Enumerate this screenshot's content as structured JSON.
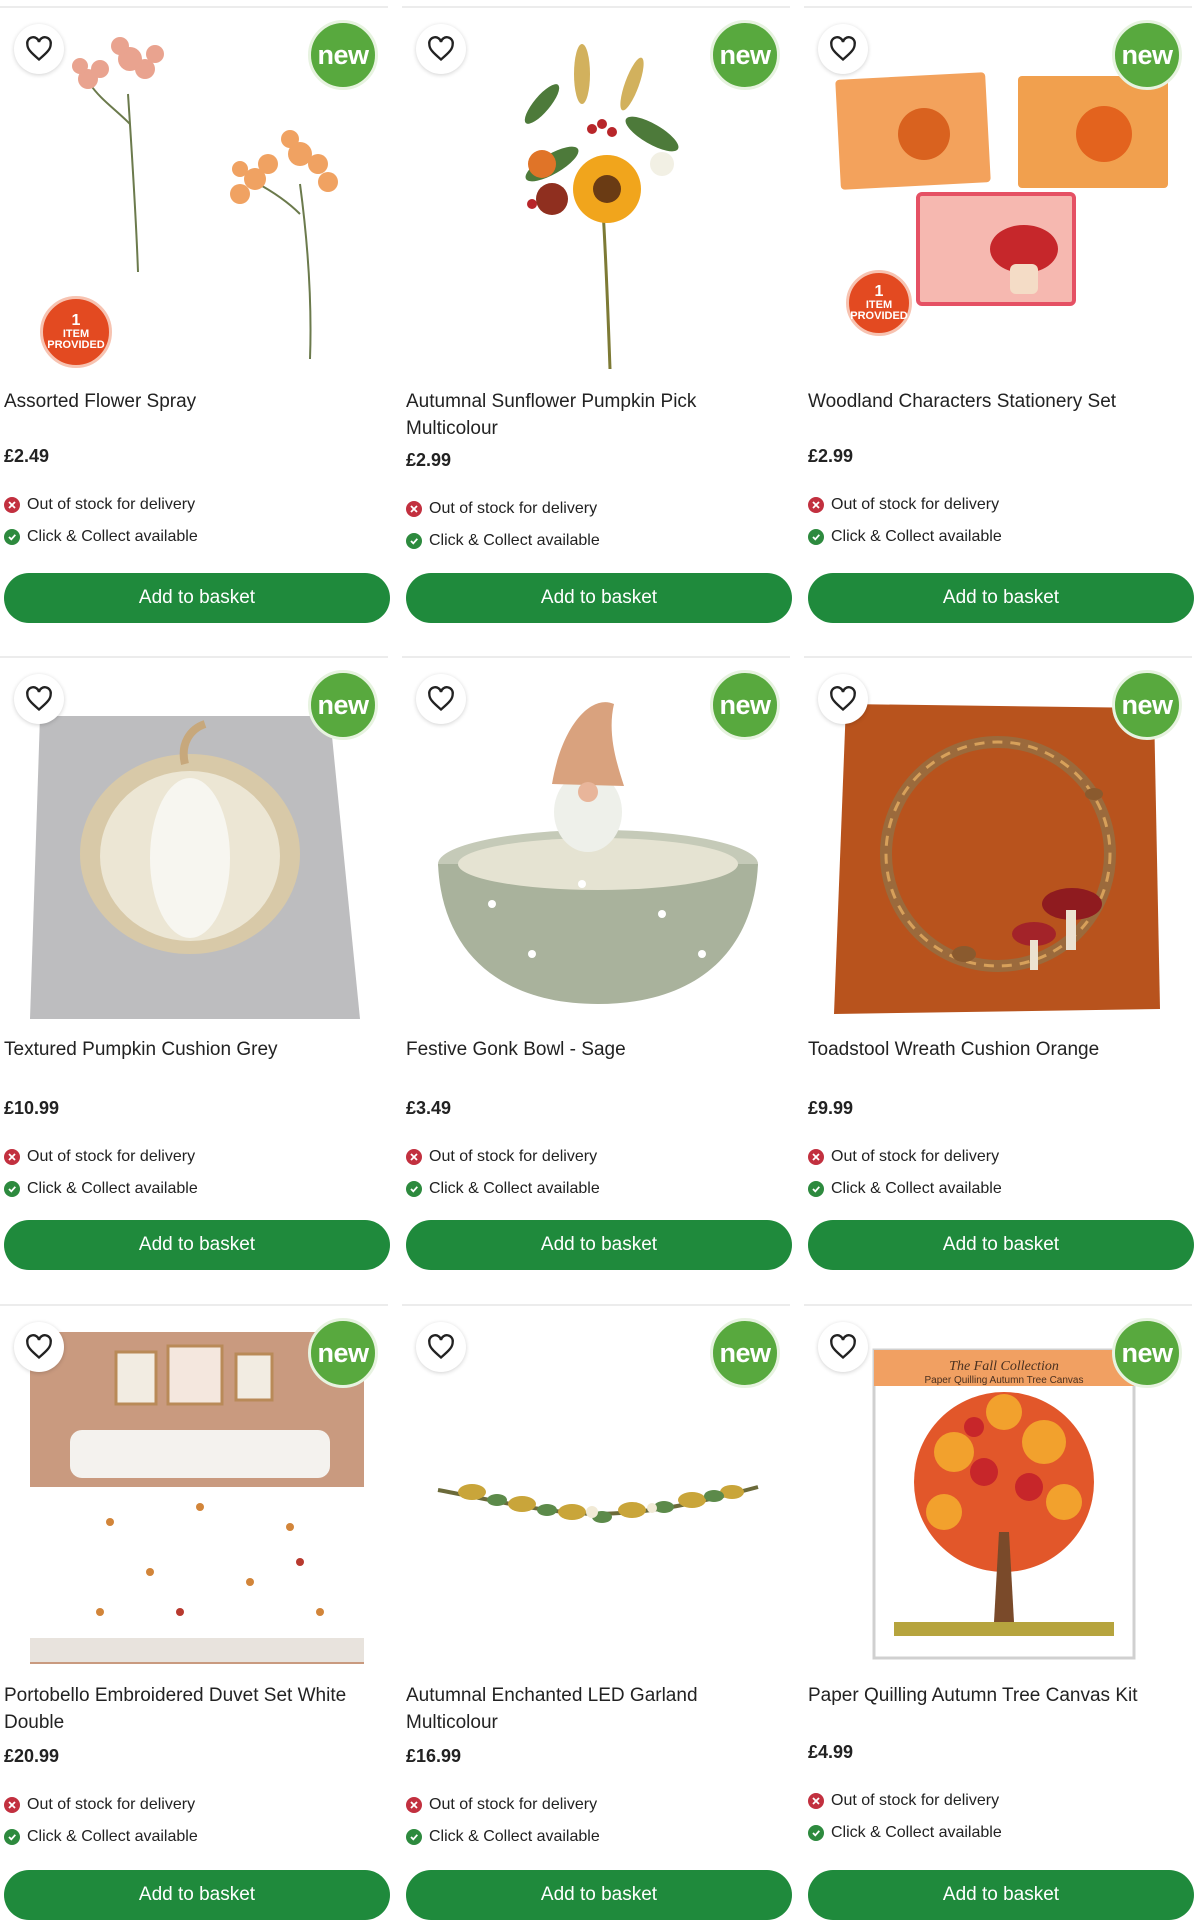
{
  "labels": {
    "new": "new",
    "item_provided_count": "1",
    "item_provided_line1": "ITEM",
    "item_provided_line2": "PROVIDED",
    "delivery": "Out of stock for delivery",
    "collect": "Click & Collect available",
    "add_to_basket": "Add to basket"
  },
  "colors": {
    "primary_green": "#1f8a3c",
    "new_badge": "#58a93e",
    "out_of_stock": "#c2303f",
    "available": "#2d8a3e"
  },
  "products": [
    {
      "title": "Assorted Flower Spray",
      "price": "£2.49"
    },
    {
      "title": "Autumnal Sunflower Pumpkin Pick Multicolour",
      "price": "£2.99"
    },
    {
      "title": "Woodland Characters Stationery Set",
      "price": "£2.99"
    },
    {
      "title": "Textured Pumpkin Cushion Grey",
      "price": "£10.99"
    },
    {
      "title": "Festive Gonk Bowl - Sage",
      "price": "£3.49"
    },
    {
      "title": "Toadstool Wreath Cushion Orange",
      "price": "£9.99"
    },
    {
      "title": "Portobello Embroidered Duvet Set White Double",
      "price": "£20.99"
    },
    {
      "title": "Autumnal Enchanted LED Garland Multicolour",
      "price": "£16.99"
    },
    {
      "title": "Paper Quilling Autumn Tree Canvas Kit",
      "price": "£4.99"
    }
  ],
  "canvas_kit": {
    "line1": "The Fall Collection",
    "line2": "Paper Quilling Autumn Tree Canvas"
  }
}
